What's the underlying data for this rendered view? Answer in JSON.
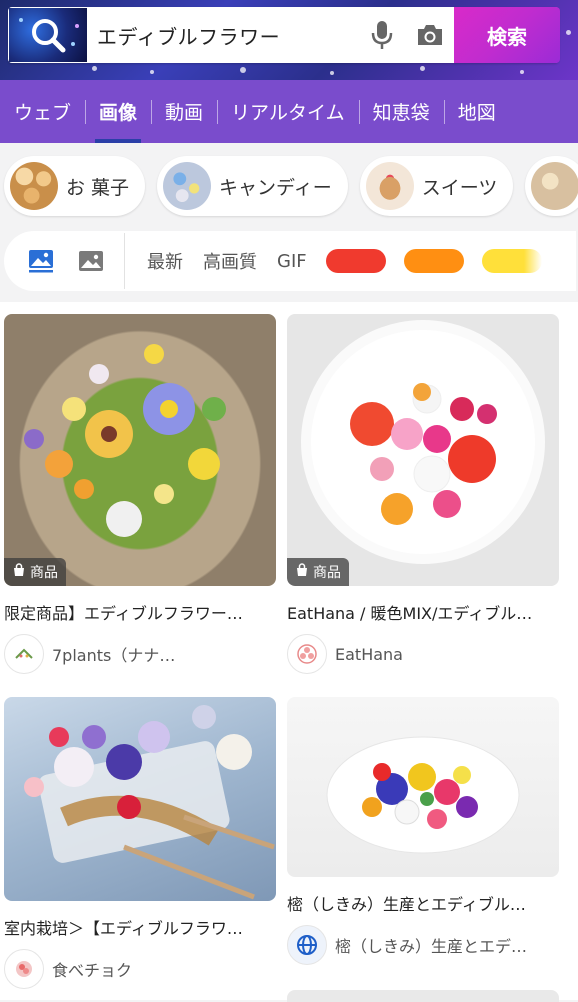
{
  "search": {
    "query": "エディブルフラワー",
    "button_label": "検索",
    "mic_icon": "mic-icon",
    "camera_icon": "camera-icon"
  },
  "tabs": [
    {
      "label": "ウェブ"
    },
    {
      "label": "画像",
      "active": true
    },
    {
      "label": "動画"
    },
    {
      "label": "リアルタイム"
    },
    {
      "label": "知恵袋"
    },
    {
      "label": "地図"
    }
  ],
  "chips": [
    {
      "label": "お 菓子"
    },
    {
      "label": "キャンディー"
    },
    {
      "label": "スイーツ"
    }
  ],
  "filters": {
    "latest": "最新",
    "hq": "高画質",
    "gif": "GIF",
    "colors": [
      "#f03a2e",
      "#ff8f12",
      "#ffe03a"
    ]
  },
  "results": [
    {
      "title": "限定商品】エディブルフラワー…",
      "source": "7plants（ナナ…",
      "badge": "商品"
    },
    {
      "title": "EatHana / 暖色MIX/エディブル…",
      "source": "EatHana",
      "badge": "商品"
    },
    {
      "title": "室内栽培＞【エディブルフラワ…",
      "source": "食べチョク"
    },
    {
      "title": "樒（しきみ）生産とエディブル…",
      "source": "樒（しきみ）生産とエデ…"
    }
  ]
}
